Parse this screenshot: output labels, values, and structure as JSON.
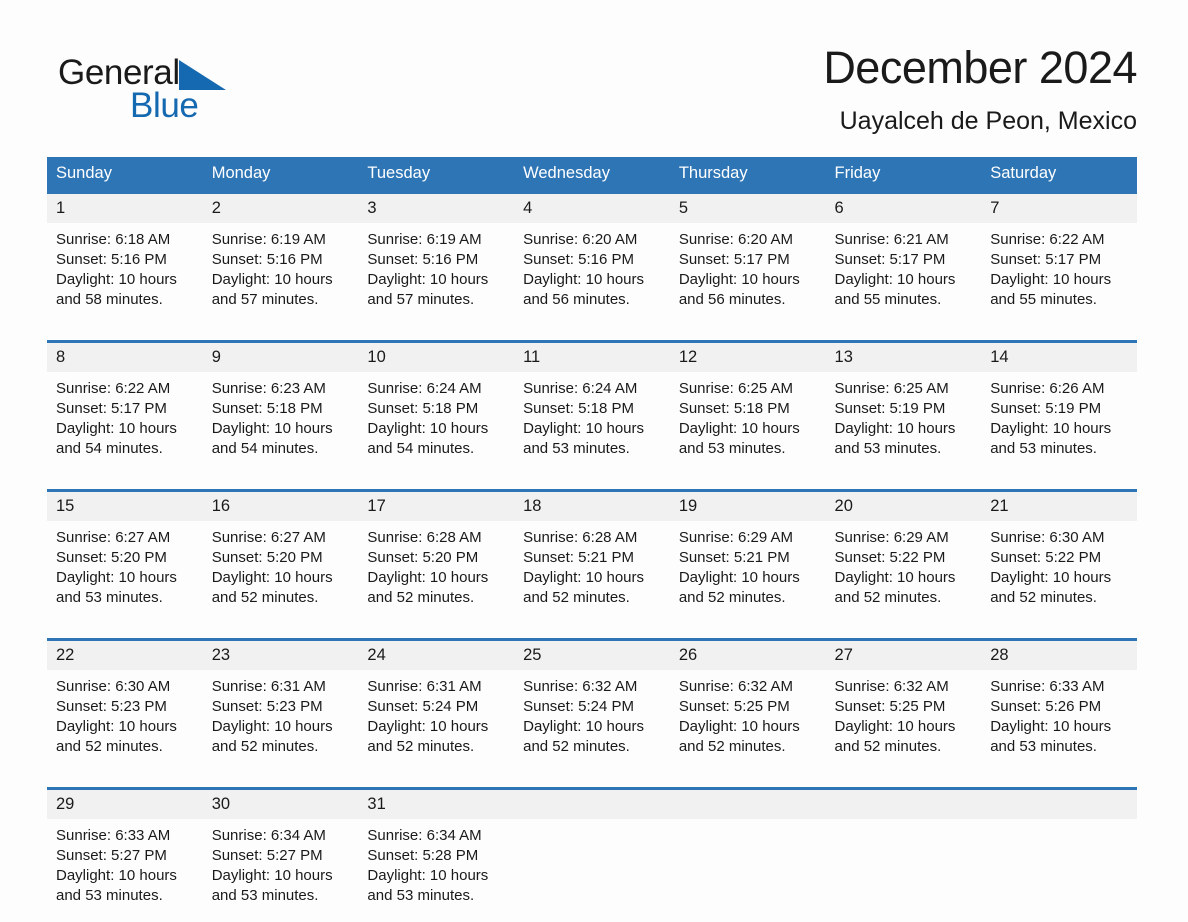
{
  "logo": {
    "word1": "General",
    "word2": "Blue",
    "triangle_icon": "logo-triangle-icon",
    "accent_color": "#1569b0"
  },
  "header": {
    "title": "December 2024",
    "subtitle": "Uayalceh de Peon, Mexico"
  },
  "theme": {
    "header_blue": "#2e75b6",
    "daynum_band": "#f1f1f1",
    "page_background": "#fdfdfd",
    "text": "#1a1a1a"
  },
  "weekday_headers": [
    "Sunday",
    "Monday",
    "Tuesday",
    "Wednesday",
    "Thursday",
    "Friday",
    "Saturday"
  ],
  "weeks": [
    {
      "days": [
        {
          "num": "1",
          "sunrise": "Sunrise: 6:18 AM",
          "sunset": "Sunset: 5:16 PM",
          "daylight1": "Daylight: 10 hours",
          "daylight2": "and 58 minutes."
        },
        {
          "num": "2",
          "sunrise": "Sunrise: 6:19 AM",
          "sunset": "Sunset: 5:16 PM",
          "daylight1": "Daylight: 10 hours",
          "daylight2": "and 57 minutes."
        },
        {
          "num": "3",
          "sunrise": "Sunrise: 6:19 AM",
          "sunset": "Sunset: 5:16 PM",
          "daylight1": "Daylight: 10 hours",
          "daylight2": "and 57 minutes."
        },
        {
          "num": "4",
          "sunrise": "Sunrise: 6:20 AM",
          "sunset": "Sunset: 5:16 PM",
          "daylight1": "Daylight: 10 hours",
          "daylight2": "and 56 minutes."
        },
        {
          "num": "5",
          "sunrise": "Sunrise: 6:20 AM",
          "sunset": "Sunset: 5:17 PM",
          "daylight1": "Daylight: 10 hours",
          "daylight2": "and 56 minutes."
        },
        {
          "num": "6",
          "sunrise": "Sunrise: 6:21 AM",
          "sunset": "Sunset: 5:17 PM",
          "daylight1": "Daylight: 10 hours",
          "daylight2": "and 55 minutes."
        },
        {
          "num": "7",
          "sunrise": "Sunrise: 6:22 AM",
          "sunset": "Sunset: 5:17 PM",
          "daylight1": "Daylight: 10 hours",
          "daylight2": "and 55 minutes."
        }
      ]
    },
    {
      "days": [
        {
          "num": "8",
          "sunrise": "Sunrise: 6:22 AM",
          "sunset": "Sunset: 5:17 PM",
          "daylight1": "Daylight: 10 hours",
          "daylight2": "and 54 minutes."
        },
        {
          "num": "9",
          "sunrise": "Sunrise: 6:23 AM",
          "sunset": "Sunset: 5:18 PM",
          "daylight1": "Daylight: 10 hours",
          "daylight2": "and 54 minutes."
        },
        {
          "num": "10",
          "sunrise": "Sunrise: 6:24 AM",
          "sunset": "Sunset: 5:18 PM",
          "daylight1": "Daylight: 10 hours",
          "daylight2": "and 54 minutes."
        },
        {
          "num": "11",
          "sunrise": "Sunrise: 6:24 AM",
          "sunset": "Sunset: 5:18 PM",
          "daylight1": "Daylight: 10 hours",
          "daylight2": "and 53 minutes."
        },
        {
          "num": "12",
          "sunrise": "Sunrise: 6:25 AM",
          "sunset": "Sunset: 5:18 PM",
          "daylight1": "Daylight: 10 hours",
          "daylight2": "and 53 minutes."
        },
        {
          "num": "13",
          "sunrise": "Sunrise: 6:25 AM",
          "sunset": "Sunset: 5:19 PM",
          "daylight1": "Daylight: 10 hours",
          "daylight2": "and 53 minutes."
        },
        {
          "num": "14",
          "sunrise": "Sunrise: 6:26 AM",
          "sunset": "Sunset: 5:19 PM",
          "daylight1": "Daylight: 10 hours",
          "daylight2": "and 53 minutes."
        }
      ]
    },
    {
      "days": [
        {
          "num": "15",
          "sunrise": "Sunrise: 6:27 AM",
          "sunset": "Sunset: 5:20 PM",
          "daylight1": "Daylight: 10 hours",
          "daylight2": "and 53 minutes."
        },
        {
          "num": "16",
          "sunrise": "Sunrise: 6:27 AM",
          "sunset": "Sunset: 5:20 PM",
          "daylight1": "Daylight: 10 hours",
          "daylight2": "and 52 minutes."
        },
        {
          "num": "17",
          "sunrise": "Sunrise: 6:28 AM",
          "sunset": "Sunset: 5:20 PM",
          "daylight1": "Daylight: 10 hours",
          "daylight2": "and 52 minutes."
        },
        {
          "num": "18",
          "sunrise": "Sunrise: 6:28 AM",
          "sunset": "Sunset: 5:21 PM",
          "daylight1": "Daylight: 10 hours",
          "daylight2": "and 52 minutes."
        },
        {
          "num": "19",
          "sunrise": "Sunrise: 6:29 AM",
          "sunset": "Sunset: 5:21 PM",
          "daylight1": "Daylight: 10 hours",
          "daylight2": "and 52 minutes."
        },
        {
          "num": "20",
          "sunrise": "Sunrise: 6:29 AM",
          "sunset": "Sunset: 5:22 PM",
          "daylight1": "Daylight: 10 hours",
          "daylight2": "and 52 minutes."
        },
        {
          "num": "21",
          "sunrise": "Sunrise: 6:30 AM",
          "sunset": "Sunset: 5:22 PM",
          "daylight1": "Daylight: 10 hours",
          "daylight2": "and 52 minutes."
        }
      ]
    },
    {
      "days": [
        {
          "num": "22",
          "sunrise": "Sunrise: 6:30 AM",
          "sunset": "Sunset: 5:23 PM",
          "daylight1": "Daylight: 10 hours",
          "daylight2": "and 52 minutes."
        },
        {
          "num": "23",
          "sunrise": "Sunrise: 6:31 AM",
          "sunset": "Sunset: 5:23 PM",
          "daylight1": "Daylight: 10 hours",
          "daylight2": "and 52 minutes."
        },
        {
          "num": "24",
          "sunrise": "Sunrise: 6:31 AM",
          "sunset": "Sunset: 5:24 PM",
          "daylight1": "Daylight: 10 hours",
          "daylight2": "and 52 minutes."
        },
        {
          "num": "25",
          "sunrise": "Sunrise: 6:32 AM",
          "sunset": "Sunset: 5:24 PM",
          "daylight1": "Daylight: 10 hours",
          "daylight2": "and 52 minutes."
        },
        {
          "num": "26",
          "sunrise": "Sunrise: 6:32 AM",
          "sunset": "Sunset: 5:25 PM",
          "daylight1": "Daylight: 10 hours",
          "daylight2": "and 52 minutes."
        },
        {
          "num": "27",
          "sunrise": "Sunrise: 6:32 AM",
          "sunset": "Sunset: 5:25 PM",
          "daylight1": "Daylight: 10 hours",
          "daylight2": "and 52 minutes."
        },
        {
          "num": "28",
          "sunrise": "Sunrise: 6:33 AM",
          "sunset": "Sunset: 5:26 PM",
          "daylight1": "Daylight: 10 hours",
          "daylight2": "and 53 minutes."
        }
      ]
    },
    {
      "days": [
        {
          "num": "29",
          "sunrise": "Sunrise: 6:33 AM",
          "sunset": "Sunset: 5:27 PM",
          "daylight1": "Daylight: 10 hours",
          "daylight2": "and 53 minutes."
        },
        {
          "num": "30",
          "sunrise": "Sunrise: 6:34 AM",
          "sunset": "Sunset: 5:27 PM",
          "daylight1": "Daylight: 10 hours",
          "daylight2": "and 53 minutes."
        },
        {
          "num": "31",
          "sunrise": "Sunrise: 6:34 AM",
          "sunset": "Sunset: 5:28 PM",
          "daylight1": "Daylight: 10 hours",
          "daylight2": "and 53 minutes."
        },
        {
          "num": "",
          "sunrise": "",
          "sunset": "",
          "daylight1": "",
          "daylight2": ""
        },
        {
          "num": "",
          "sunrise": "",
          "sunset": "",
          "daylight1": "",
          "daylight2": ""
        },
        {
          "num": "",
          "sunrise": "",
          "sunset": "",
          "daylight1": "",
          "daylight2": ""
        },
        {
          "num": "",
          "sunrise": "",
          "sunset": "",
          "daylight1": "",
          "daylight2": ""
        }
      ]
    }
  ]
}
